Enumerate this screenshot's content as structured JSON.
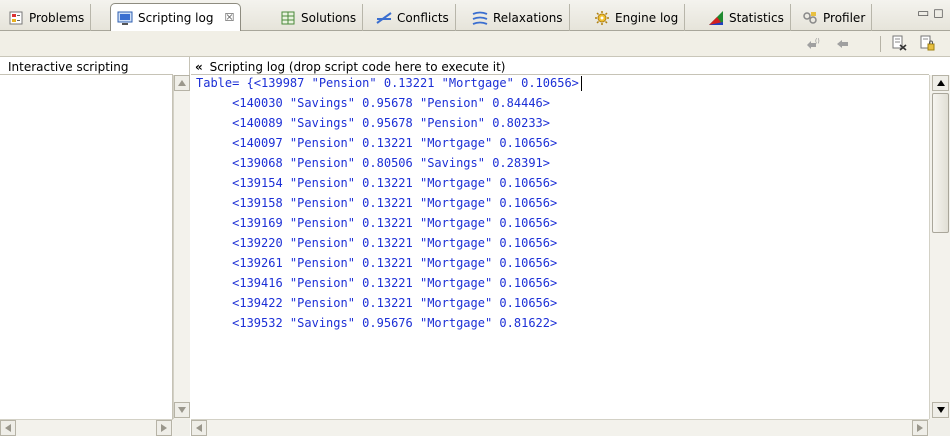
{
  "tabs": [
    {
      "label": "Problems",
      "icon": "problems-icon"
    },
    {
      "label": "Scripting log",
      "icon": "scripting-log-icon",
      "active": true,
      "close": "☒"
    },
    {
      "label": "Solutions",
      "icon": "solutions-icon"
    },
    {
      "label": "Conflicts",
      "icon": "conflicts-icon"
    },
    {
      "label": "Relaxations",
      "icon": "relaxations-icon"
    },
    {
      "label": "Engine log",
      "icon": "engine-log-icon"
    },
    {
      "label": "Statistics",
      "icon": "statistics-icon"
    },
    {
      "label": "Profiler",
      "icon": "profiler-icon"
    }
  ],
  "window_controls": {
    "minimize": "▭",
    "maximize": "◻"
  },
  "left": {
    "header": "Interactive scripting"
  },
  "right": {
    "header_chevron": "«",
    "header": "Scripting log (drop script code here to execute it)"
  },
  "log_lines": [
    "Table= {<139987 \"Pension\" 0.13221 \"Mortgage\" 0.10656>",
    "     <140030 \"Savings\" 0.95678 \"Pension\" 0.84446>",
    "     <140089 \"Savings\" 0.95678 \"Pension\" 0.80233>",
    "     <140097 \"Pension\" 0.13221 \"Mortgage\" 0.10656>",
    "     <139068 \"Pension\" 0.80506 \"Savings\" 0.28391>",
    "     <139154 \"Pension\" 0.13221 \"Mortgage\" 0.10656>",
    "     <139158 \"Pension\" 0.13221 \"Mortgage\" 0.10656>",
    "     <139169 \"Pension\" 0.13221 \"Mortgage\" 0.10656>",
    "     <139220 \"Pension\" 0.13221 \"Mortgage\" 0.10656>",
    "     <139261 \"Pension\" 0.13221 \"Mortgage\" 0.10656>",
    "     <139416 \"Pension\" 0.13221 \"Mortgage\" 0.10656>",
    "     <139422 \"Pension\" 0.13221 \"Mortgage\" 0.10656>",
    "     <139532 \"Savings\" 0.95676 \"Mortgage\" 0.81622>"
  ],
  "colors": {
    "log_text": "#1c2fd6",
    "chrome": "#ece9d8"
  }
}
